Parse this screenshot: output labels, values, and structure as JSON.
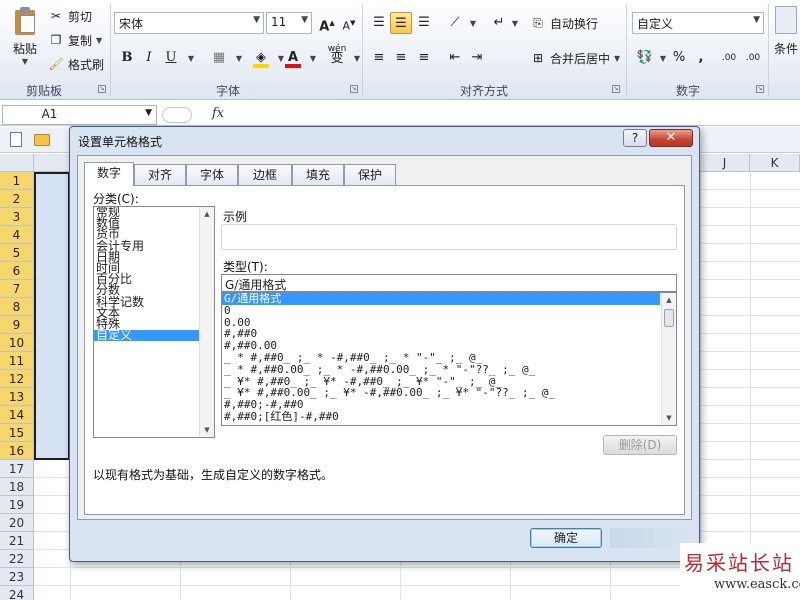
{
  "ribbon": {
    "clipboard": {
      "paste": "粘贴",
      "cut": "剪切",
      "copy": "复制",
      "format_painter": "格式刷",
      "group": "剪贴板"
    },
    "font": {
      "name": "宋体",
      "size": "11",
      "grow": "A",
      "shrink": "A",
      "bold": "B",
      "italic": "I",
      "underline": "U",
      "phonetic": "wén",
      "group": "字体",
      "fill_color": "#ffd700",
      "font_color": "#e01010"
    },
    "alignment": {
      "wrap": "自动换行",
      "merge": "合并后居中",
      "group": "对齐方式"
    },
    "number": {
      "format": "自定义",
      "percent": "%",
      "comma": ",",
      "inc_dec": ".00",
      "dec_dec": ".00",
      "group": "数字"
    },
    "styles": {
      "conditional": "条件"
    }
  },
  "formula_bar": {
    "name_box": "A1",
    "fx": "fx"
  },
  "sheet": {
    "columns": [
      "J",
      "K"
    ],
    "rows": [
      "1",
      "2",
      "3",
      "4",
      "5",
      "6",
      "7",
      "8",
      "9",
      "10",
      "11",
      "12",
      "13",
      "14",
      "15",
      "16",
      "17",
      "18",
      "19",
      "20",
      "21",
      "22",
      "23",
      "24"
    ],
    "selected_rows": 16
  },
  "dialog": {
    "title": "设置单元格格式",
    "help": "?",
    "close": "✕",
    "tabs": [
      "数字",
      "对齐",
      "字体",
      "边框",
      "填充",
      "保护"
    ],
    "active_tab": 0,
    "category_label": "分类(C):",
    "categories": [
      "常规",
      "数值",
      "货币",
      "会计专用",
      "日期",
      "时间",
      "百分比",
      "分数",
      "科学记数",
      "文本",
      "特殊",
      "自定义"
    ],
    "selected_category": 11,
    "sample_label": "示例",
    "type_label": "类型(T):",
    "type_value": "G/通用格式",
    "formats": [
      "G/通用格式",
      "0",
      "0.00",
      "#,##0",
      "#,##0.00",
      "_ * #,##0_ ;_ * -#,##0_ ;_ * \"-\"_ ;_ @_",
      "_ * #,##0.00_ ;_ * -#,##0.00_ ;_ * \"-\"??_ ;_ @_",
      "_ ¥* #,##0_ ;_ ¥* -#,##0_ ;_ ¥* \"-\"_ ;_ @_",
      "_ ¥* #,##0.00_ ;_ ¥* -#,##0.00_ ;_ ¥* \"-\"??_ ;_ @_",
      "#,##0;-#,##0",
      "#,##0;[红色]-#,##0"
    ],
    "selected_format": 0,
    "delete_button": "删除(D)",
    "description": "以现有格式为基础，生成自定义的数字格式。",
    "ok_button": "确定"
  },
  "watermark": {
    "cn": "易采站长站",
    "en": "www.easck.com"
  }
}
